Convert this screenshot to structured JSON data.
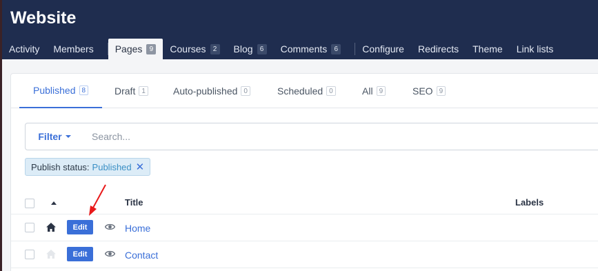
{
  "app": {
    "title": "Website"
  },
  "nav": {
    "items": [
      {
        "label": "Activity",
        "badge": null
      },
      {
        "label": "Members",
        "badge": null
      },
      {
        "label": "Pages",
        "badge": "9"
      },
      {
        "label": "Courses",
        "badge": "2"
      },
      {
        "label": "Blog",
        "badge": "6"
      },
      {
        "label": "Comments",
        "badge": "6"
      },
      {
        "label": "Configure",
        "badge": null
      },
      {
        "label": "Redirects",
        "badge": null
      },
      {
        "label": "Theme",
        "badge": null
      },
      {
        "label": "Link lists",
        "badge": null
      }
    ],
    "active": "Pages"
  },
  "tabs": [
    {
      "label": "Published",
      "count": "8"
    },
    {
      "label": "Draft",
      "count": "1"
    },
    {
      "label": "Auto-published",
      "count": "0"
    },
    {
      "label": "Scheduled",
      "count": "0"
    },
    {
      "label": "All",
      "count": "9"
    },
    {
      "label": "SEO",
      "count": "9"
    }
  ],
  "active_tab": "Published",
  "filter": {
    "label": "Filter",
    "search_placeholder": "Search..."
  },
  "active_filter": {
    "label": "Publish status:",
    "value": "Published"
  },
  "table": {
    "columns": {
      "title": "Title",
      "labels": "Labels"
    },
    "rows": [
      {
        "title": "Home",
        "is_homepage": true,
        "edit_label": "Edit"
      },
      {
        "title": "Contact",
        "is_homepage": false,
        "edit_label": "Edit"
      }
    ]
  },
  "colors": {
    "header_bg": "#1f2d4f",
    "accent": "#3a6fd8",
    "annotation": "#e8191a"
  },
  "icons": [
    "caret-down-icon",
    "close-icon",
    "sort-up-icon",
    "home-icon",
    "eye-icon",
    "annotation-arrow"
  ]
}
